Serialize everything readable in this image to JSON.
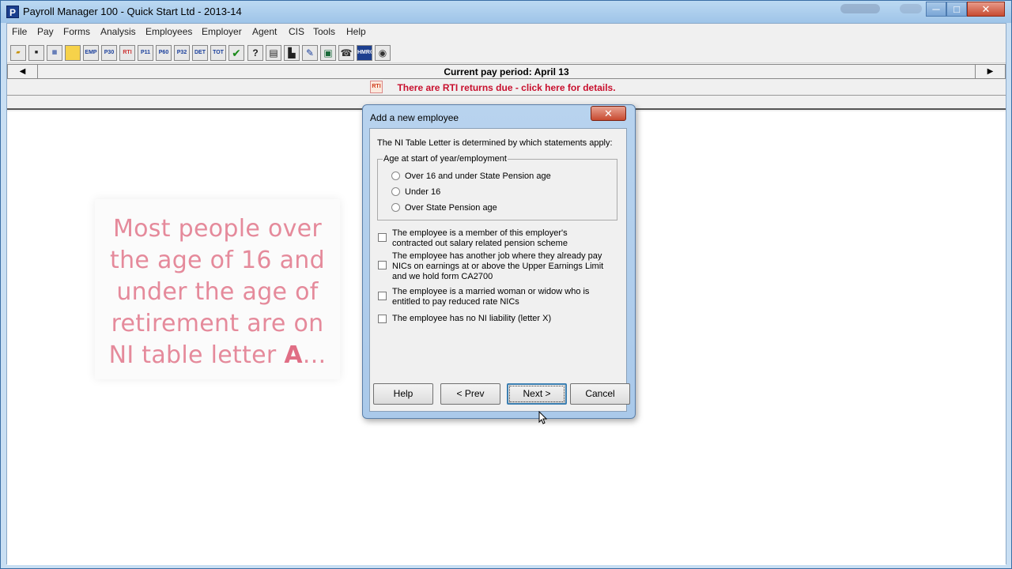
{
  "window": {
    "title": "Payroll Manager 100  -  Quick Start Ltd  -  2013-14",
    "app_icon": "P"
  },
  "menu": [
    "File",
    "Pay",
    "Forms",
    "Analysis",
    "Employees",
    "Employer",
    "Agent",
    "CIS",
    "Tools",
    "Help"
  ],
  "toolbar": [
    "open-folder-icon",
    "save-icon",
    "calendar-icon",
    "note-icon",
    "EMP",
    "P30",
    "RTI",
    "P11",
    "P60",
    "P32",
    "DET",
    "TOT",
    "check-icon",
    "help-circle-icon",
    "ledger-icon",
    "factory-icon",
    "wrench-icon",
    "calculator-icon",
    "phone-icon",
    "HMRC",
    "globe-icon"
  ],
  "toolbar_labels": {
    "emp": "EMP",
    "p30": "P30",
    "rti": "RTI",
    "p11": "P11",
    "p60": "P60",
    "p32": "P32",
    "det": "DET",
    "tot": "TOT",
    "hmrc": "HMRC"
  },
  "period": {
    "text": "Current pay period: April 13",
    "prev": "◀",
    "next": "▶"
  },
  "rti": {
    "icon": "RTI",
    "text": "There are RTI returns due - click here for details."
  },
  "tip": {
    "text": "Most people over the age of 16 and under the age of retirement are on NI table letter ",
    "bold": "A",
    "suffix": "..."
  },
  "dialog": {
    "title": "Add a new employee",
    "close": "✕",
    "intro": "The NI Table Letter is determined by which statements apply:",
    "group_label": "Age at start of year/employment",
    "radios": [
      "Over 16 and under State Pension age",
      "Under 16",
      "Over State Pension age"
    ],
    "checkboxes": [
      "The employee is a member of this employer's contracted out salary related pension scheme",
      "The employee has another job where they already pay NICs on earnings at or above the Upper Earnings Limit and we hold form CA2700",
      "The employee is a married woman or widow who is entitled to pay reduced rate NICs",
      "The employee has no NI liability (letter X)"
    ],
    "buttons": {
      "help": "Help",
      "prev": "< Prev",
      "next": "Next >",
      "cancel": "Cancel"
    }
  }
}
